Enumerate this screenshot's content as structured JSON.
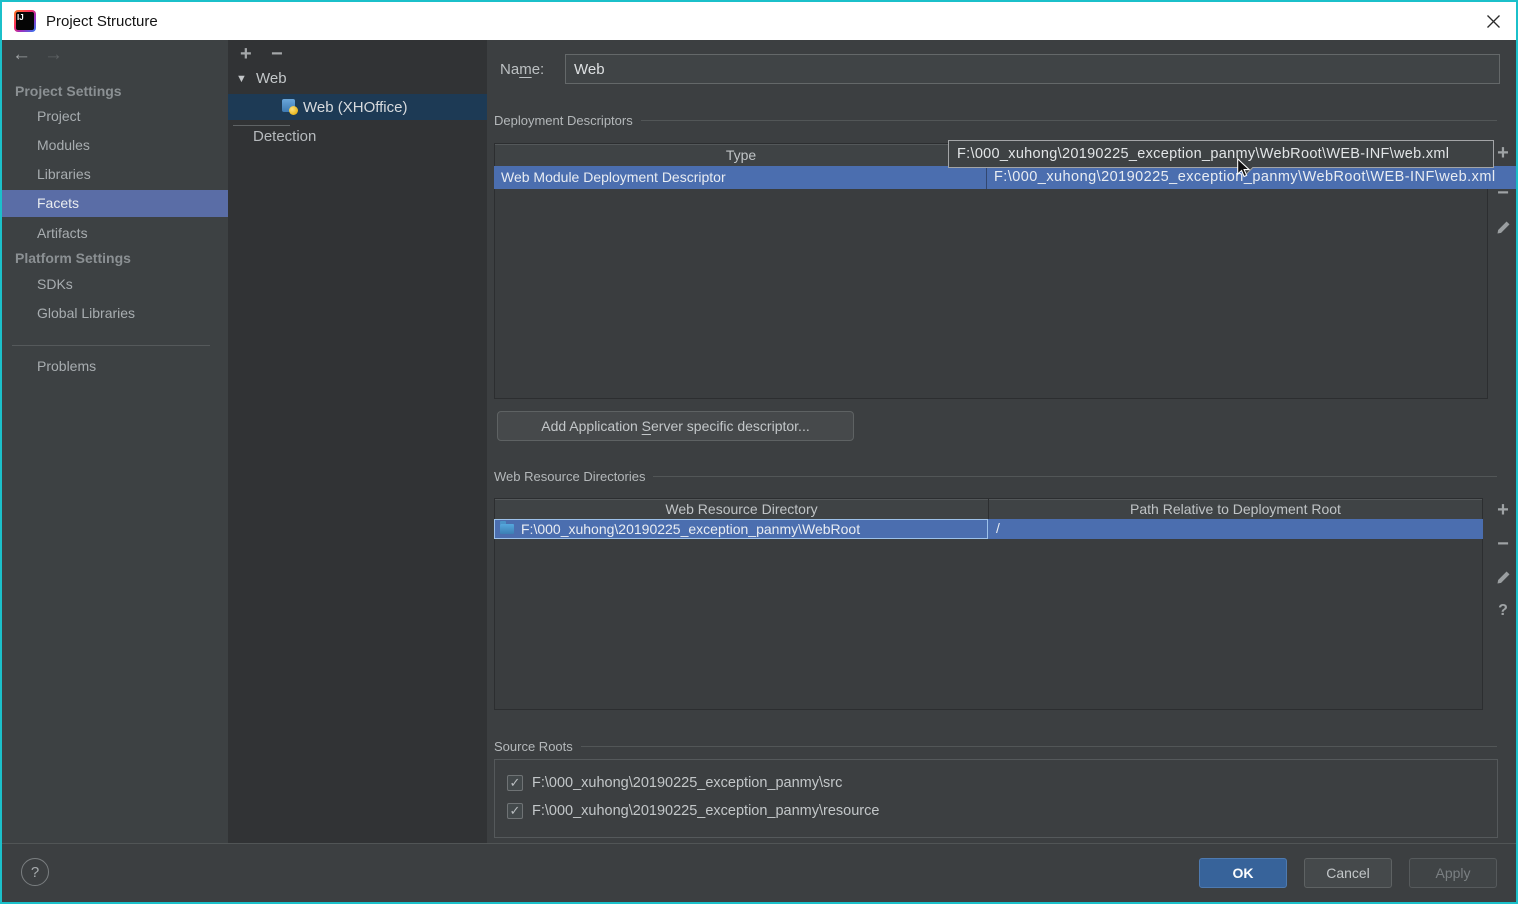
{
  "window": {
    "title": "Project Structure"
  },
  "icons": {
    "plus": "+",
    "minus": "−",
    "help": "?",
    "back_arrow": "←",
    "forward_arrow": "→",
    "expand_triangle": "▼",
    "checkmark": "✓"
  },
  "colors": {
    "window_border_teal": "#1bc0ca",
    "table_selection_blue": "#4b6eaf",
    "sidebar_selection_blue": "#5a6da6",
    "tree_selection_navy": "#1d3a55",
    "ok_button_blue": "#37639a"
  },
  "sidebar": {
    "sections": [
      {
        "header": "Project Settings",
        "items": [
          "Project",
          "Modules",
          "Libraries",
          "Facets",
          "Artifacts"
        ]
      },
      {
        "header": "Platform Settings",
        "items": [
          "SDKs",
          "Global Libraries"
        ]
      }
    ],
    "selected_item": "Facets",
    "problems_item": "Problems"
  },
  "tree": {
    "root_label": "Web",
    "selected_node": "Web (XHOffice)",
    "detection_label": "Detection"
  },
  "form": {
    "name_label": {
      "pre": "Na",
      "mnemonic": "m",
      "post": "e:"
    },
    "name_value": "Web"
  },
  "deployment": {
    "section_title": "Deployment Descriptors",
    "type_header": "Type",
    "row": {
      "type": "Web Module Deployment Descriptor",
      "path": "F:\\000_xuhong\\20190225_exception_panmy\\WebRoot\\WEB-INF\\web.xml"
    },
    "tooltip": "F:\\000_xuhong\\20190225_exception_panmy\\WebRoot\\WEB-INF\\web.xml",
    "add_button": {
      "pre": "Add Application ",
      "mnemonic": "S",
      "post": "erver specific descriptor..."
    }
  },
  "resources": {
    "section_title": "Web Resource Directories",
    "headers": [
      "Web Resource Directory",
      "Path Relative to Deployment Root"
    ],
    "row": {
      "dir": "F:\\000_xuhong\\20190225_exception_panmy\\WebRoot",
      "path": "/"
    }
  },
  "source_roots": {
    "section_title": "Source Roots",
    "items": [
      {
        "checked": true,
        "path": "F:\\000_xuhong\\20190225_exception_panmy\\src"
      },
      {
        "checked": true,
        "path": "F:\\000_xuhong\\20190225_exception_panmy\\resource"
      }
    ]
  },
  "footer": {
    "ok": "OK",
    "cancel": "Cancel",
    "apply": "Apply"
  }
}
